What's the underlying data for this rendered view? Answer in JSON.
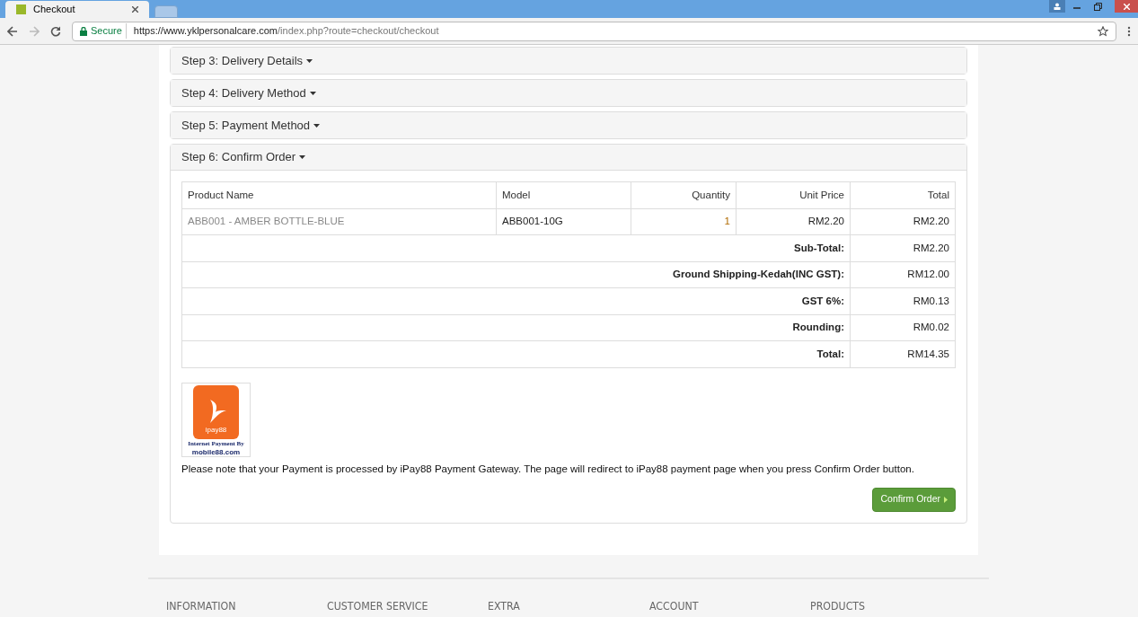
{
  "browser": {
    "tabs": [
      {
        "title": "Checkout",
        "selected": true
      },
      {
        "selected": false
      }
    ],
    "secure_label": "Secure",
    "url_host": "https://www.yklpersonalcare.com",
    "url_path": "/index.php?route=checkout/checkout"
  },
  "steps": [
    {
      "title": "Step 3: Delivery Details",
      "expanded": false
    },
    {
      "title": "Step 4: Delivery Method",
      "expanded": false
    },
    {
      "title": "Step 5: Payment Method",
      "expanded": false
    },
    {
      "title": "Step 6: Confirm Order",
      "expanded": true
    }
  ],
  "table": {
    "columns": [
      "Product Name",
      "Model",
      "Quantity",
      "Unit Price",
      "Total"
    ],
    "rows": [
      [
        "ABB001 - AMBER BOTTLE-BLUE",
        "ABB001-10G",
        "1",
        "RM2.20",
        "RM2.20"
      ]
    ],
    "totals": [
      {
        "label": "Sub-Total:",
        "value": "RM2.20"
      },
      {
        "label": "Ground Shipping-Kedah(INC GST):",
        "value": "RM12.00"
      },
      {
        "label": "GST 6%:",
        "value": "RM0.13"
      },
      {
        "label": "Rounding:",
        "value": "RM0.02"
      },
      {
        "label": "Total:",
        "value": "RM14.35"
      }
    ]
  },
  "payment_logo": {
    "brand": "ipay88",
    "line1": "Internet Payment By",
    "line2": "mobile88.com"
  },
  "note": "Please note that your Payment is processed by iPay88 Payment Gateway. The page will redirect to iPay88 payment page when you press Confirm Order button.",
  "confirm_button": "Confirm Order",
  "footer": [
    "INFORMATION",
    "CUSTOMER SERVICE",
    "EXTRA",
    "ACCOUNT",
    "PRODUCTS"
  ]
}
